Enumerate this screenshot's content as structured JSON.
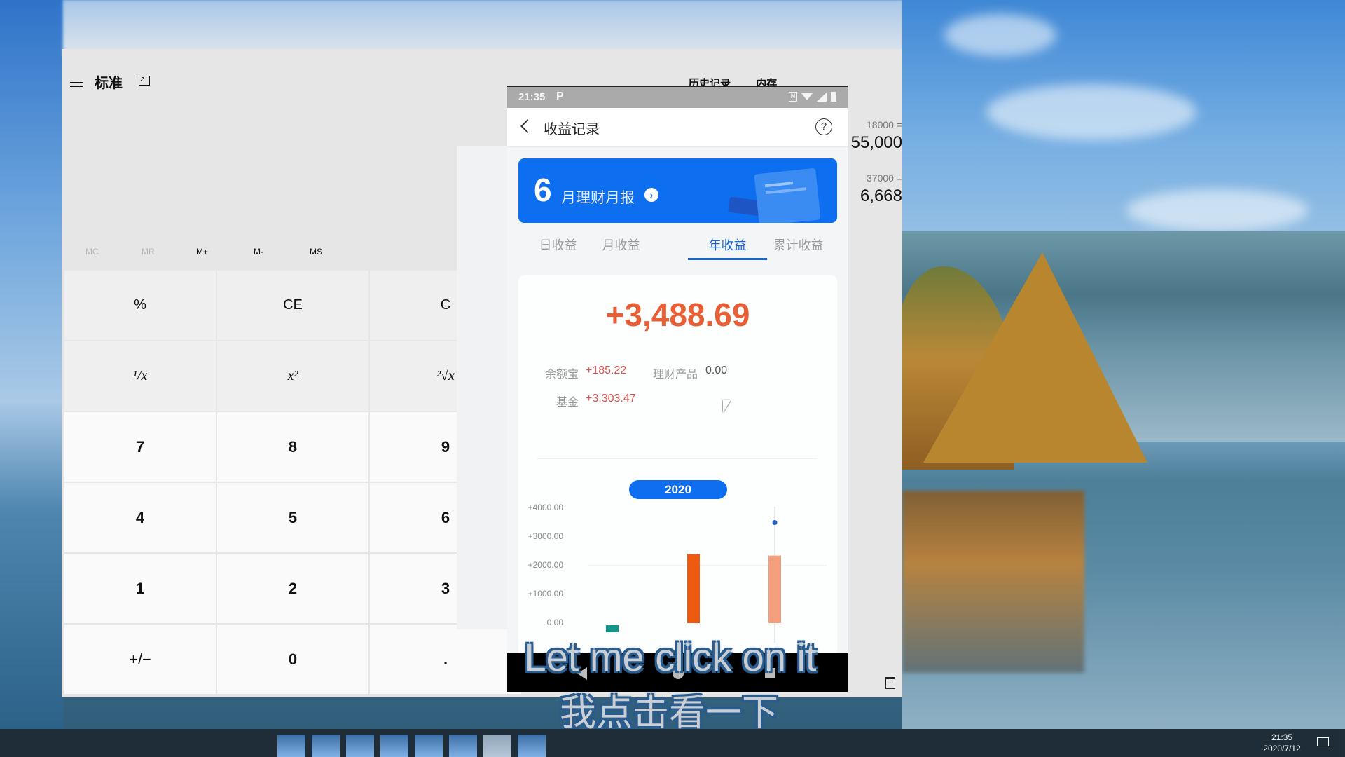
{
  "calculator": {
    "mode_title": "标准",
    "side_tabs": [
      "历史记录",
      "内存"
    ],
    "memory_buttons": [
      {
        "label": "MC",
        "enabled": false
      },
      {
        "label": "MR",
        "enabled": false
      },
      {
        "label": "M+",
        "enabled": true
      },
      {
        "label": "M-",
        "enabled": true
      },
      {
        "label": "MS",
        "enabled": true
      }
    ],
    "keys": [
      [
        "%",
        "CE",
        "C"
      ],
      [
        "¹/x",
        "x²",
        "²√x"
      ],
      [
        "7",
        "8",
        "9"
      ],
      [
        "4",
        "5",
        "6"
      ],
      [
        "1",
        "2",
        "3"
      ],
      [
        "+/−",
        "0",
        "."
      ]
    ],
    "history": [
      {
        "expression": "18000 =",
        "result": "55,000"
      },
      {
        "expression": "37000 =",
        "result": "6,668"
      }
    ]
  },
  "phone": {
    "status_bar": {
      "time": "21:35",
      "notification_icon": "P"
    },
    "header": {
      "title": "收益记录",
      "help_icon": "?"
    },
    "banner": {
      "month": "6",
      "label": "月理财月报"
    },
    "tabs": [
      {
        "label": "日收益",
        "active": false
      },
      {
        "label": "月收益",
        "active": false
      },
      {
        "label": "年收益",
        "active": true
      },
      {
        "label": "累计收益",
        "active": false
      }
    ],
    "summary": {
      "total": "+3,488.69",
      "breakdown": [
        {
          "label": "余额宝",
          "value": "+185.22"
        },
        {
          "label": "理财产品",
          "value": "0.00"
        },
        {
          "label": "基金",
          "value": "+3,303.47"
        }
      ]
    },
    "year_pill": "2020"
  },
  "chart_data": {
    "type": "bar",
    "title": "",
    "year": "2020",
    "ylabel": "",
    "yticks": [
      "+4000.00",
      "+3000.00",
      "+2000.00",
      "+1000.00",
      "0.00"
    ],
    "ylim": [
      0,
      4000
    ],
    "bars": [
      {
        "name": "bar-1",
        "value": -100,
        "color": "#14958a"
      },
      {
        "name": "bar-2",
        "value": 2400,
        "color": "#ee5a12"
      },
      {
        "name": "bar-3",
        "value": 2350,
        "color": "#f4a07e"
      }
    ],
    "highlight_point": {
      "bar_index": 2,
      "value": 3500,
      "color": "#2a5dc7"
    }
  },
  "subtitles": {
    "en": "Let me click on it",
    "zh": "我点击看一下"
  },
  "taskbar": {
    "time": "21:35",
    "date": "2020/7/12"
  }
}
